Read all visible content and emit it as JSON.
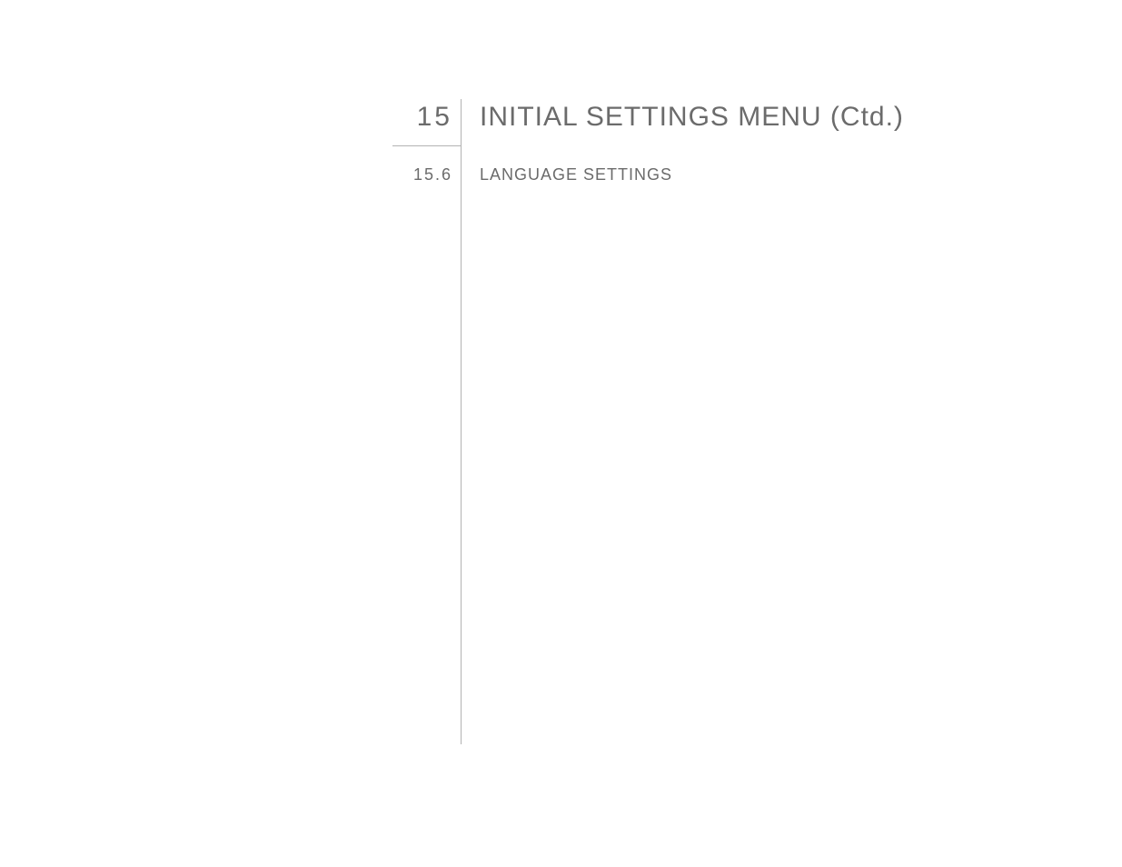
{
  "chapter": {
    "number": "15",
    "title": "INITIAL SETTINGS MENU (Ctd.)"
  },
  "section": {
    "number": "15.6",
    "title": "LANGUAGE SETTINGS"
  }
}
